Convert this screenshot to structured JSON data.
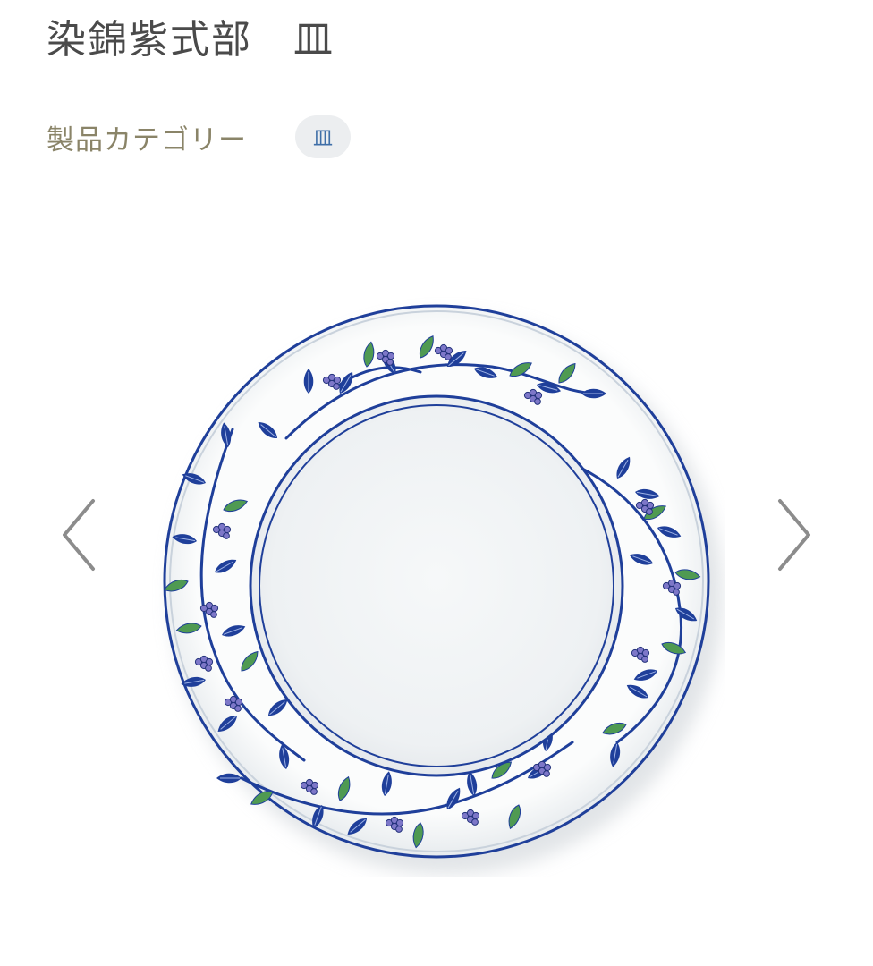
{
  "product": {
    "title": "染錦紫式部　皿"
  },
  "category": {
    "label": "製品カテゴリー",
    "chip": "皿"
  },
  "gallery": {
    "prev_icon": "chevron-left-icon",
    "next_icon": "chevron-right-icon",
    "image_subject": "plate-photo"
  },
  "colors": {
    "title_text": "#4a4a4a",
    "category_label": "#8a8468",
    "chip_bg": "#eceef0",
    "chip_text": "#3f6fa8",
    "arrow": "#8c8c8c",
    "plate_blue": "#1f3f9a",
    "leaf_green": "#4f9a52",
    "berry_purple": "#7d77c8"
  }
}
